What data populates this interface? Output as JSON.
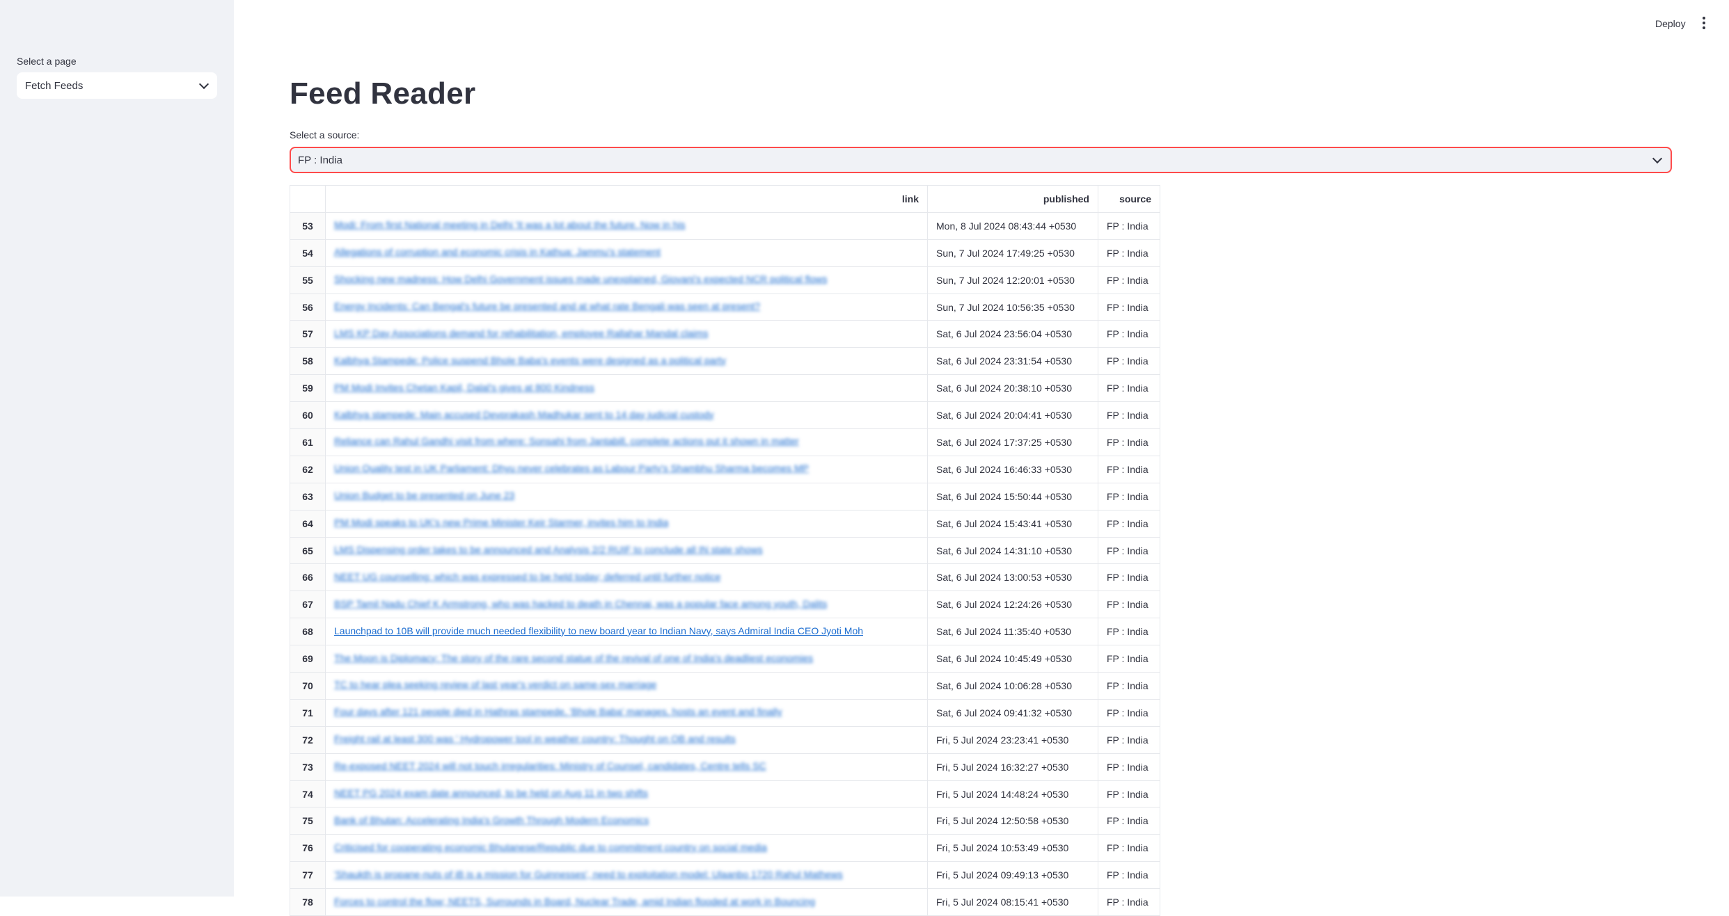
{
  "sidebar": {
    "label": "Select a page",
    "selected": "Fetch Feeds"
  },
  "header": {
    "deploy_label": "Deploy"
  },
  "main": {
    "title": "Feed Reader",
    "source_label": "Select a source:",
    "source_selected": "FP : India"
  },
  "table": {
    "columns": [
      "",
      "link",
      "published",
      "source"
    ],
    "rows": [
      {
        "idx": "53",
        "link": "Modi: From first National meeting in Delhi 'It was a lot about the future. Now in his",
        "published": "Mon, 8 Jul 2024 08:43:44 +0530",
        "source": "FP : India"
      },
      {
        "idx": "54",
        "link": "Allegations of corruption and economic crisis in Kathua: Jammu’s statement",
        "published": "Sun, 7 Jul 2024 17:49:25 +0530",
        "source": "FP : India"
      },
      {
        "idx": "55",
        "link": "Shocking new madness: How Delhi Government issues made unexplained, Giovani's expected NCR political flows",
        "published": "Sun, 7 Jul 2024 12:20:01 +0530",
        "source": "FP : India"
      },
      {
        "idx": "56",
        "link": "Energy Incidents: Can Bengal's future be presented and at what rate Bengali was seen at present?",
        "published": "Sun, 7 Jul 2024 10:56:35 +0530",
        "source": "FP : India"
      },
      {
        "idx": "57",
        "link": "LMS KP Day Associations demand for rehabilitation, employee Rallahar Mandal claims",
        "published": "Sat, 6 Jul 2024 23:56:04 +0530",
        "source": "FP : India"
      },
      {
        "idx": "58",
        "link": "Kalbhya Stampede: Police suspend Bhole Baba's events were designed as a political party",
        "published": "Sat, 6 Jul 2024 23:31:54 +0530",
        "source": "FP : India"
      },
      {
        "idx": "59",
        "link": "PM Modi Invites Chetan Kapil, Dalal's gives at 800 Kindness",
        "published": "Sat, 6 Jul 2024 20:38:10 +0530",
        "source": "FP : India"
      },
      {
        "idx": "60",
        "link": "Kalbhya stampede: Main accused Devprakash Madhukar sent to 14 day judicial custody",
        "published": "Sat, 6 Jul 2024 20:04:41 +0530",
        "source": "FP : India"
      },
      {
        "idx": "61",
        "link": "Reliance can Rahul Gandhi visit from where: Sonsahi from Jantabill, complete actions put it shown in matter",
        "published": "Sat, 6 Jul 2024 17:37:25 +0530",
        "source": "FP : India"
      },
      {
        "idx": "62",
        "link": "Union Quality test in UK Parliament: Dhyu never celebrates as Labour Party's Shambhu Sharma becomes MP",
        "published": "Sat, 6 Jul 2024 16:46:33 +0530",
        "source": "FP : India"
      },
      {
        "idx": "63",
        "link": "Union Budget to be presented on June 23",
        "published": "Sat, 6 Jul 2024 15:50:44 +0530",
        "source": "FP : India"
      },
      {
        "idx": "64",
        "link": "PM Modi speaks to UK's new Prime Minister Keir Starmer, invites him to India",
        "published": "Sat, 6 Jul 2024 15:43:41 +0530",
        "source": "FP : India"
      },
      {
        "idx": "65",
        "link": "LMS Dispensing order takes to be announced and Analysis 2/2 RUIF to conclude all IN state shows",
        "published": "Sat, 6 Jul 2024 14:31:10 +0530",
        "source": "FP : India"
      },
      {
        "idx": "66",
        "link": "NEET UG counselling: which was expressed to be held today; deferred until further notice",
        "published": "Sat, 6 Jul 2024 13:00:53 +0530",
        "source": "FP : India"
      },
      {
        "idx": "67",
        "link": "BSP Tamil Nadu Chief K Armstrong, who was hacked to death in Chennai, was a popular face among youth, Dalits",
        "published": "Sat, 6 Jul 2024 12:24:26 +0530",
        "source": "FP : India"
      },
      {
        "idx": "68",
        "link": "Launchpad to 10B will provide much needed flexibility to new board year to Indian Navy, says Admiral India CEO Jyoti Mohanty",
        "published": "Sat, 6 Jul 2024 11:35:40 +0530",
        "source": "FP : India"
      },
      {
        "idx": "69",
        "link": "The Moon is Diplomacy: The story of the rare second statue of the revival of one of India's deadliest economies",
        "published": "Sat, 6 Jul 2024 10:45:49 +0530",
        "source": "FP : India"
      },
      {
        "idx": "70",
        "link": "TC to hear plea seeking review of last year's verdict on same-sex marriage",
        "published": "Sat, 6 Jul 2024 10:06:28 +0530",
        "source": "FP : India"
      },
      {
        "idx": "71",
        "link": "Four days after 121 people died in Hathras stampede, 'Bhole Baba' manages, hosts an event and finally",
        "published": "Sat, 6 Jul 2024 09:41:32 +0530",
        "source": "FP : India"
      },
      {
        "idx": "72",
        "link": "Freight rail at least 300 was ' Hydropower tool in weather country: Thought on OB and results",
        "published": "Fri, 5 Jul 2024 23:23:41 +0530",
        "source": "FP : India"
      },
      {
        "idx": "73",
        "link": "Re-exposed NEET 2024 will not touch irregularities: Ministry of Counsel, candidates, Centre tells SC",
        "published": "Fri, 5 Jul 2024 16:32:27 +0530",
        "source": "FP : India"
      },
      {
        "idx": "74",
        "link": "NEET PG 2024 exam date announced, to be held on Aug 11 in two shifts",
        "published": "Fri, 5 Jul 2024 14:48:24 +0530",
        "source": "FP : India"
      },
      {
        "idx": "75",
        "link": "Bank of Bhutan: Accelerating India's Growth Through Modern Economics",
        "published": "Fri, 5 Jul 2024 12:50:58 +0530",
        "source": "FP : India"
      },
      {
        "idx": "76",
        "link": "Criticised for cooperating economic Bhutanese/Republic due to commitment country on social media",
        "published": "Fri, 5 Jul 2024 10:53:49 +0530",
        "source": "FP : India"
      },
      {
        "idx": "77",
        "link": "'Shaukth is propane-nuts of iB is a mission for Guinnesses', need to exploitation model: Ulaanbo 1720 Rahul Mathews",
        "published": "Fri, 5 Jul 2024 09:49:13 +0530",
        "source": "FP : India"
      },
      {
        "idx": "78",
        "link": "Forces to control the flow; NEETS, Surrounds in Board, Nuclear Trade, amid Indian flooded at work in Bouncing",
        "published": "Fri, 5 Jul 2024 08:15:41 +0530",
        "source": "FP : India"
      }
    ]
  }
}
